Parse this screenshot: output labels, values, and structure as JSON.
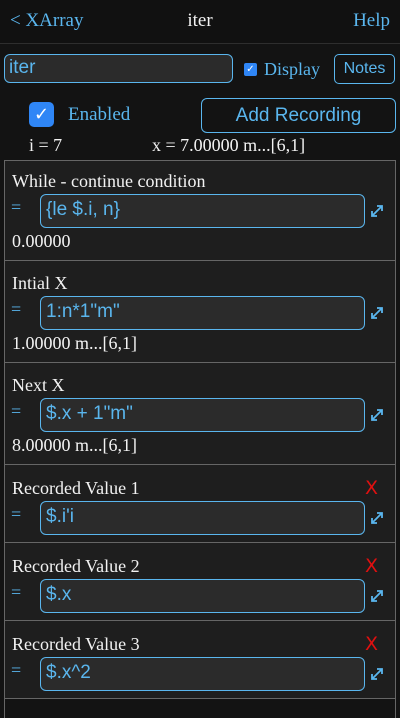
{
  "nav": {
    "back_label": "< XArray",
    "title": "iter",
    "help_label": "Help"
  },
  "header": {
    "name_value": "iter",
    "display_label": "Display",
    "display_checked": true,
    "notes_label": "Notes"
  },
  "controls": {
    "enabled_label": "Enabled",
    "enabled_checked": true,
    "add_recording_label": "Add Recording",
    "i_status": "i = 7",
    "x_status": "x = 7.00000 m...[6,1]"
  },
  "sections": {
    "while": {
      "title": "While - continue condition",
      "eq": "=",
      "expr": "{le $.i, n}",
      "result": "0.00000"
    },
    "initial": {
      "title": "Intial X",
      "eq": "=",
      "expr": "1:n*1\"m\"",
      "result": "1.00000 m...[6,1]"
    },
    "next": {
      "title": "Next X",
      "eq": "=",
      "expr": "$.x + 1\"m\"",
      "result": "8.00000 m...[6,1]"
    },
    "rec1": {
      "title": "Recorded Value 1",
      "eq": "=",
      "expr": "$.i'i",
      "delete": "X"
    },
    "rec2": {
      "title": "Recorded Value 2",
      "eq": "=",
      "expr": "$.x",
      "delete": "X"
    },
    "rec3": {
      "title": "Recorded Value 3",
      "eq": "=",
      "expr": "$.x^2",
      "delete": "X"
    }
  },
  "icons": {
    "expand": "expand-arrows-icon",
    "check": "checkmark-icon"
  },
  "colors": {
    "accent": "#5ab6ee",
    "checkbox": "#2f86f6",
    "delete": "#e01010",
    "background": "#131313",
    "panel": "#1e1e1e",
    "input_bg": "#2b2b2b"
  }
}
